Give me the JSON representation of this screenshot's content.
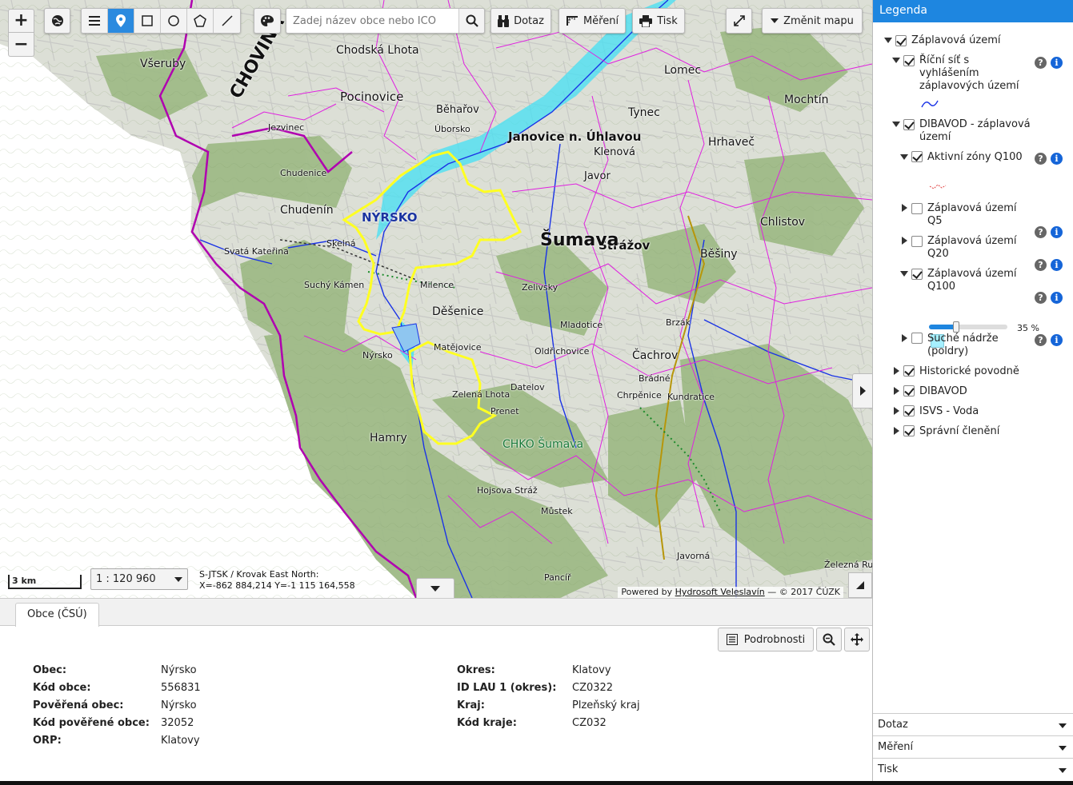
{
  "toolbar": {
    "zoom_in": "+",
    "zoom_out": "−",
    "search_placeholder": "Zadej název obce nebo IČO",
    "dotaz_label": "Dotaz",
    "mereni_label": "Měření",
    "tisk_label": "Tisk",
    "zmenit_mapu_label": "Změnit mapu"
  },
  "map": {
    "scale_bar_label": "3 km",
    "scale_value": "1 : 120 960",
    "coords_system": "S-JTSK / Krovak East North:",
    "coords_value": "X=-862 884,214 Y=-1 115 164,558",
    "attribution_prefix": "Powered by",
    "attribution_link": "Hydrosoft Veleslavín",
    "attribution_suffix": "— © 2017 ČÚZK",
    "place_labels": [
      "CHOVINA",
      "Všeruby",
      "Chodská Lhota",
      "Pocinovice",
      "Jezvinec",
      "Chudenín",
      "NÝRSKO",
      "Skelná",
      "Svatá Kateřina",
      "Suchý Kámen",
      "Hamry",
      "Děšenice",
      "Milence",
      "Matějovice",
      "Zelená Lhota",
      "Datelov",
      "Prenet",
      "CHKO Šumava",
      "Nýrsko",
      "Běhařov",
      "Úborsko",
      "Janovice n. Úhlavou",
      "Klenová",
      "Javor",
      "Strážov",
      "Lomec",
      "Tynec",
      "Mochtín",
      "Hrhaveč",
      "Chlistov",
      "Běšiny",
      "Čachrov",
      "Brzák",
      "Železná Ruda",
      "Hojsova Stráž",
      "Můstek",
      "Pancíř",
      "Zelivsky",
      "Chudenice",
      "Šumava",
      "Brádné",
      "Javorná",
      "Kundratice",
      "Oldřichovice",
      "Mladotice",
      "Chrpěnice"
    ]
  },
  "legend": {
    "title": "Legenda",
    "items": [
      {
        "label": "Záplavová území",
        "checked": true,
        "expanded": true
      },
      {
        "label": "Říční síť s vyhlášením záplavových území",
        "checked": true,
        "expanded": true
      },
      {
        "label": "DIBAVOD - záplavová území",
        "checked": true,
        "expanded": true
      },
      {
        "label": "Aktivní zóny Q100",
        "checked": true,
        "expanded": true
      },
      {
        "label": "Záplavová území Q5",
        "checked": false,
        "expanded": false
      },
      {
        "label": "Záplavová území Q20",
        "checked": false,
        "expanded": false
      },
      {
        "label": "Záplavová území Q100",
        "checked": true,
        "expanded": true
      },
      {
        "label": "Suché nádrže (poldry)",
        "checked": false,
        "expanded": false
      },
      {
        "label": "Historické povodně",
        "checked": true,
        "expanded": false
      },
      {
        "label": "DIBAVOD",
        "checked": true,
        "expanded": false
      },
      {
        "label": "ISVS - Voda",
        "checked": true,
        "expanded": false
      },
      {
        "label": "Správní členění",
        "checked": true,
        "expanded": false
      }
    ],
    "opacity_percent": 35,
    "opacity_label": "35 %",
    "help_icon": "?",
    "info_icon": "i",
    "accordion": [
      "Dotaz",
      "Měření",
      "Tisk"
    ]
  },
  "bottom": {
    "tab_label": "Obce (ČSÚ)",
    "podrobnosti_label": "Podrobnosti",
    "attributes_left": [
      {
        "key": "Obec",
        "value": "Nýrsko"
      },
      {
        "key": "Kód obce",
        "value": "556831"
      },
      {
        "key": "Pověřená obec",
        "value": "Nýrsko"
      },
      {
        "key": "Kód pověřené obce",
        "value": "32052"
      },
      {
        "key": "ORP",
        "value": "Klatovy"
      }
    ],
    "attributes_right": [
      {
        "key": "Okres",
        "value": "Klatovy"
      },
      {
        "key": "ID LAU 1 (okres)",
        "value": "CZ0322"
      },
      {
        "key": "Kraj",
        "value": "Plzeňský kraj"
      },
      {
        "key": "Kód kraje",
        "value": "CZ032"
      }
    ],
    "colon": ":"
  },
  "colors": {
    "accent": "#1e86e0",
    "selection": "#ffff00",
    "boundary": "#e020e0",
    "region_boundary": "#b000b0",
    "flood": "#40e0f0",
    "river": "#1030e0",
    "forest": "#97b882",
    "terrain": "#d8ddd0"
  }
}
